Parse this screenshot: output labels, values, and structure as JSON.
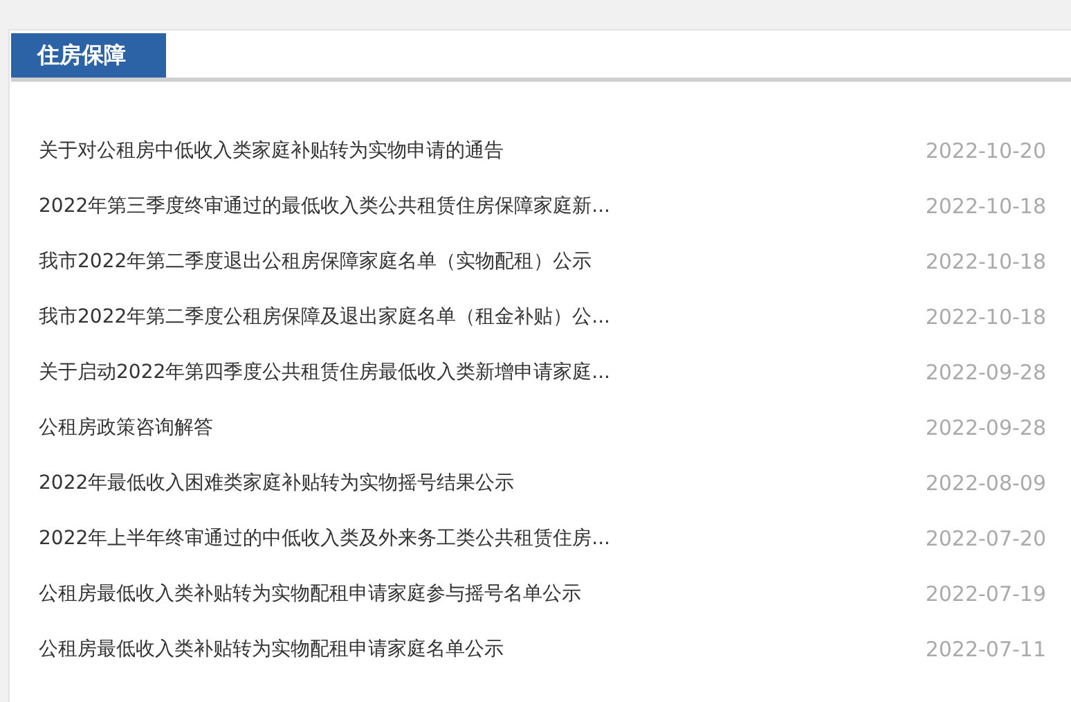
{
  "section": {
    "title": "住房保障"
  },
  "news": [
    {
      "title": "关于对公租房中低收入类家庭补贴转为实物申请的通告",
      "date": "2022-10-20"
    },
    {
      "title": "2022年第三季度终审通过的最低收入类公共租赁住房保障家庭新...",
      "date": "2022-10-18"
    },
    {
      "title": "我市2022年第二季度退出公租房保障家庭名单（实物配租）公示",
      "date": "2022-10-18"
    },
    {
      "title": "我市2022年第二季度公租房保障及退出家庭名单（租金补贴）公...",
      "date": "2022-10-18"
    },
    {
      "title": "关于启动2022年第四季度公共租赁住房最低收入类新增申请家庭...",
      "date": "2022-09-28"
    },
    {
      "title": "公租房政策咨询解答",
      "date": "2022-09-28"
    },
    {
      "title": "2022年最低收入困难类家庭补贴转为实物摇号结果公示",
      "date": "2022-08-09"
    },
    {
      "title": "2022年上半年终审通过的中低收入类及外来务工类公共租赁住房...",
      "date": "2022-07-20"
    },
    {
      "title": "公租房最低收入类补贴转为实物配租申请家庭参与摇号名单公示",
      "date": "2022-07-19"
    },
    {
      "title": "公租房最低收入类补贴转为实物配租申请家庭名单公示",
      "date": "2022-07-11"
    }
  ]
}
